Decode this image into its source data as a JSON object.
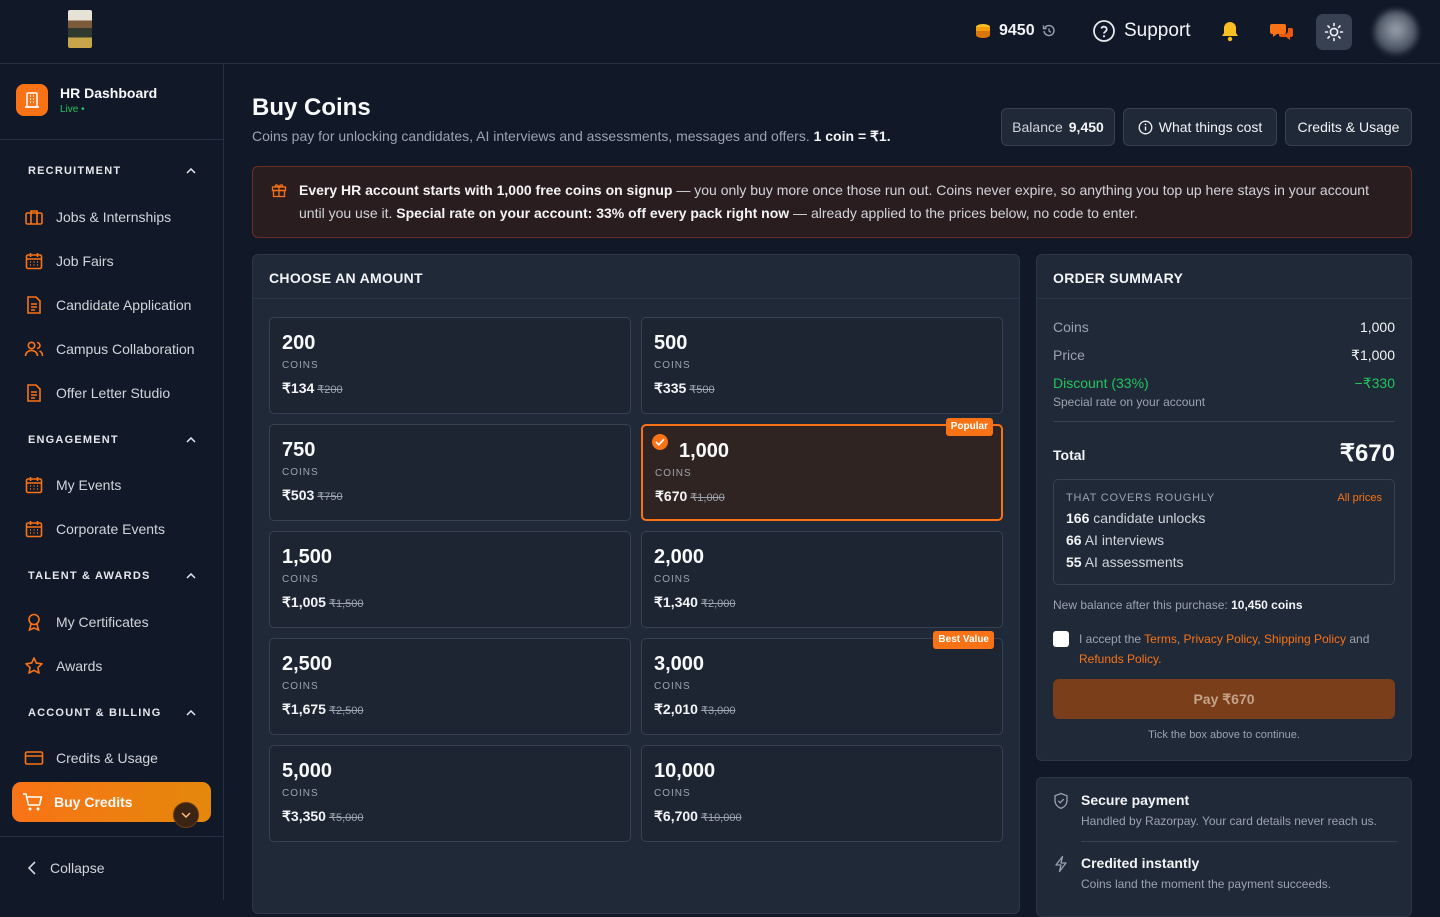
{
  "topbar": {
    "coins_value": "9450",
    "support_label": "Support",
    "icons": [
      "coins-icon",
      "history-icon",
      "help-circle-icon",
      "bell-icon",
      "chat-icon",
      "sun-icon"
    ]
  },
  "sidebar": {
    "brand_title": "HR Dashboard",
    "brand_status": "Live",
    "sections": [
      {
        "label": "RECRUITMENT",
        "items": [
          "Jobs & Internships",
          "Job Fairs",
          "Candidate Application",
          "Campus Collaboration",
          "Offer Letter Studio"
        ]
      },
      {
        "label": "ENGAGEMENT",
        "items": [
          "My Events",
          "Corporate Events"
        ]
      },
      {
        "label": "TALENT & AWARDS",
        "items": [
          "My Certificates",
          "Awards"
        ]
      },
      {
        "label": "ACCOUNT & BILLING",
        "items": [
          "Credits & Usage",
          "Buy Credits"
        ]
      }
    ],
    "collapse_label": "Collapse"
  },
  "page": {
    "title": "Buy Coins",
    "subtitle": "Coins pay for unlocking candidates, AI interviews and assessments, messages and offers.",
    "subtitle_rate": "1 coin = ₹1.",
    "balance_label": "Balance",
    "balance_value": "9,450",
    "what_cost_label": "What things cost",
    "credits_usage_label": "Credits & Usage"
  },
  "banner": {
    "bold1": "Every HR account starts with 1,000 free coins on signup",
    "text1": " — you only buy more once those run out. Coins never expire, so anything you top up here stays in your account until you use it. ",
    "bold2": "Special rate on your account: 33% off every pack right now",
    "text2": " — already applied to the prices below, no code to enter."
  },
  "amounts": {
    "heading": "CHOOSE AN AMOUNT",
    "unit_label": "COINS",
    "packs": [
      {
        "coins": "200",
        "price": "₹134",
        "original": "₹200",
        "tag": "",
        "selected": false
      },
      {
        "coins": "500",
        "price": "₹335",
        "original": "₹500",
        "tag": "",
        "selected": false
      },
      {
        "coins": "750",
        "price": "₹503",
        "original": "₹750",
        "tag": "",
        "selected": false
      },
      {
        "coins": "1,000",
        "price": "₹670",
        "original": "₹1,000",
        "tag": "Popular",
        "selected": true
      },
      {
        "coins": "1,500",
        "price": "₹1,005",
        "original": "₹1,500",
        "tag": "",
        "selected": false
      },
      {
        "coins": "2,000",
        "price": "₹1,340",
        "original": "₹2,000",
        "tag": "",
        "selected": false
      },
      {
        "coins": "2,500",
        "price": "₹1,675",
        "original": "₹2,500",
        "tag": "",
        "selected": false
      },
      {
        "coins": "3,000",
        "price": "₹2,010",
        "original": "₹3,000",
        "tag": "Best Value",
        "selected": false
      },
      {
        "coins": "5,000",
        "price": "₹3,350",
        "original": "₹5,000",
        "tag": "",
        "selected": false
      },
      {
        "coins": "10,000",
        "price": "₹6,700",
        "original": "₹10,000",
        "tag": "",
        "selected": false
      }
    ]
  },
  "summary": {
    "heading": "ORDER SUMMARY",
    "coins_label": "Coins",
    "coins_value": "1,000",
    "price_label": "Price",
    "price_value": "₹1,000",
    "discount_label": "Discount (33%)",
    "discount_value": "−₹330",
    "discount_note": "Special rate on your account",
    "total_label": "Total",
    "total_value": "₹670",
    "covers_heading": "THAT COVERS ROUGHLY",
    "all_prices_label": "All prices",
    "covers": [
      {
        "n": "166",
        "text": " candidate unlocks"
      },
      {
        "n": "66",
        "text": " AI interviews"
      },
      {
        "n": "55",
        "text": " AI assessments"
      }
    ],
    "new_balance_label": "New balance after this purchase:",
    "new_balance_value": "10,450 coins",
    "accept_prefix": "I accept the ",
    "terms": "Terms",
    "privacy": "Privacy Policy",
    "shipping": "Shipping Policy",
    "and": " and ",
    "refunds": "Refunds Policy.",
    "pay_label": "Pay ₹670",
    "tick_note": "Tick the box above to continue."
  },
  "trust": [
    {
      "title": "Secure payment",
      "desc": "Handled by Razorpay. Your card details never reach us."
    },
    {
      "title": "Credited instantly",
      "desc": "Coins land the moment the payment succeeds."
    }
  ],
  "colors": {
    "accent": "#f97316",
    "bg": "#111827",
    "panel": "#1f2937",
    "success": "#22c55e"
  }
}
